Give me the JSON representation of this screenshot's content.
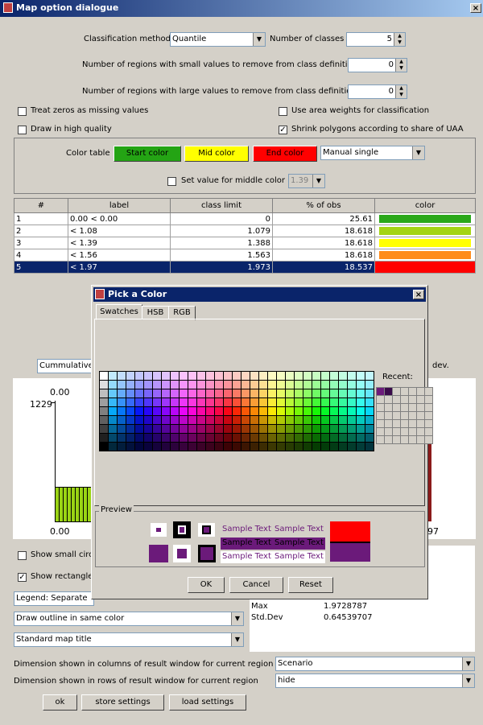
{
  "window": {
    "title": "Map option dialogue",
    "close_glyph": "×"
  },
  "classification": {
    "method_label": "Classification method",
    "method_value": "Quantile",
    "classes_label": "Number of classes",
    "classes_value": "5",
    "small_label": "Number of regions with small values to remove from class definition",
    "small_value": "0",
    "large_label": "Number of regions with large values to remove from class definition",
    "large_value": "0"
  },
  "options": {
    "treat_zeros": {
      "label": "Treat zeros as missing values",
      "checked": false
    },
    "area_weights": {
      "label": "Use area weights for classification",
      "checked": false
    },
    "high_quality": {
      "label": "Draw in high quality",
      "checked": false
    },
    "shrink_polygons": {
      "label": "Shrink polygons according to share of UAA",
      "checked": true
    }
  },
  "color_table": {
    "label": "Color table",
    "start": "Start color",
    "mid": "Mid color",
    "end": "End color",
    "mode": "Manual single",
    "middle_label": "Set value for middle color",
    "middle_value": "1.39"
  },
  "colors": {
    "start": "#24a414",
    "mid": "#ffff00",
    "end": "#ff0000",
    "accent": "#0a246a",
    "purple": "#6b1a7a"
  },
  "table": {
    "headers": [
      "#",
      "label",
      "class limit",
      "% of obs",
      "color"
    ],
    "rows": [
      {
        "n": "1",
        "label": "0.00 < 0.00",
        "limit": "0",
        "pct": "25.61",
        "color": "#2aa81a"
      },
      {
        "n": "2",
        "label": "< 1.08",
        "limit": "1.079",
        "pct": "18.618",
        "color": "#a4d414"
      },
      {
        "n": "3",
        "label": "< 1.39",
        "limit": "1.388",
        "pct": "18.618",
        "color": "#ffff00"
      },
      {
        "n": "4",
        "label": "< 1.56",
        "limit": "1.563",
        "pct": "18.618",
        "color": "#ff8c1a"
      },
      {
        "n": "5",
        "label": "< 1.97",
        "limit": "1.973",
        "pct": "18.537",
        "color": "#ff0000"
      }
    ]
  },
  "lower": {
    "cumulative": "Cummulative",
    "dev": "dev.",
    "axis_top": "0.00",
    "axis_max": "1229",
    "axis_bottom": "0.00",
    "axis_right": "97",
    "show_small": "Show small circl",
    "show_rect": "Show rectangle",
    "legend": "Legend: Separate",
    "outline": "Draw outline in same color",
    "title": "Standard map title",
    "stats": [
      {
        "k": "Max",
        "v": "1.9728787"
      },
      {
        "k": "Std.Dev",
        "v": "0.64539707"
      }
    ],
    "dim_cols_label": "Dimension shown in columns of result window for current region",
    "dim_cols_value": "Scenario",
    "dim_rows_label": "Dimension shown in rows of result window for current region",
    "dim_rows_value": "hide",
    "ok": "ok",
    "store": "store settings",
    "load": "load settings"
  },
  "picker": {
    "title": "Pick a Color",
    "tabs": [
      "Swatches",
      "HSB",
      "RGB"
    ],
    "recent_label": "Recent:",
    "preview_label": "Preview",
    "sample": "Sample Text",
    "ok": "OK",
    "cancel": "Cancel",
    "reset": "Reset"
  }
}
